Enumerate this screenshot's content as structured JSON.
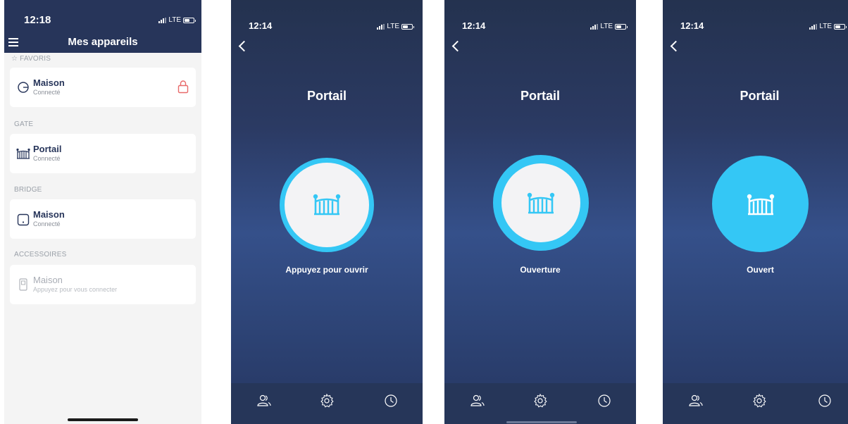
{
  "screen_list": {
    "status_time": "12:18",
    "network": "LTE",
    "title": "Mes appareils",
    "sections": {
      "favoris": "FAVORIS",
      "gate": "GATE",
      "bridge": "BRIDGE",
      "accessoires": "ACCESSOIRES"
    },
    "items": {
      "fav_maison": {
        "name": "Maison",
        "status": "Connecté"
      },
      "portail": {
        "name": "Portail",
        "status": "Connecté"
      },
      "bridge_maison": {
        "name": "Maison",
        "status": "Connecté"
      },
      "acc_maison": {
        "name": "Maison",
        "status": "Appuyez pour vous connecter"
      }
    }
  },
  "gate_screens": [
    {
      "status_time": "12:14",
      "network": "LTE",
      "title": "Portail",
      "action_label": "Appuyez pour ouvrir",
      "state": "closed"
    },
    {
      "status_time": "12:14",
      "network": "LTE",
      "title": "Portail",
      "action_label": "Ouverture",
      "state": "opening"
    },
    {
      "status_time": "12:14",
      "network": "LTE",
      "title": "Portail",
      "action_label": "Ouvert",
      "state": "open"
    }
  ],
  "colors": {
    "navy": "#27355a",
    "accent_cyan": "#34c7f5",
    "lock_red": "#e86a6a"
  },
  "icons": [
    "menu-icon",
    "star-icon",
    "lock-icon",
    "gate-icon",
    "bridge-icon",
    "accessory-icon",
    "back-icon",
    "users-icon",
    "settings-icon",
    "history-icon"
  ]
}
